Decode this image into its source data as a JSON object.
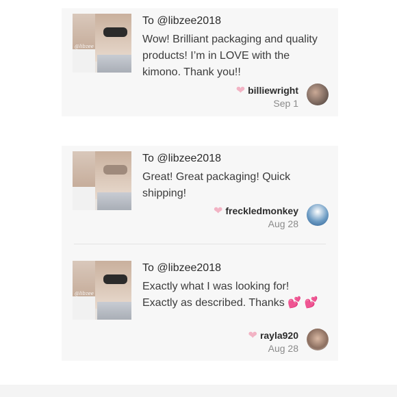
{
  "reviews": [
    {
      "to": "To @libzee2018",
      "message": "Wow! Brilliant packaging and quality products! I’m in LOVE with the kimono. Thank you!!",
      "username": "billiewright",
      "date": "Sep 1",
      "thumb_watermark": "@libzee",
      "avatar_icon": "profile-photo-icon"
    },
    {
      "to": "To @libzee2018",
      "message": "Great! Great packaging! Quick shipping!",
      "username": "freckledmonkey",
      "date": "Aug 28",
      "avatar_icon": "profile-photo-icon"
    },
    {
      "to": "To @libzee2018",
      "message": "Exactly what I was looking for! Exactly as described. Thanks",
      "emoji": "💕",
      "emoji2": "💕",
      "username": "rayla920",
      "date": "Aug 28",
      "thumb_watermark": "@libzee",
      "avatar_icon": "profile-photo-icon"
    }
  ],
  "colors": {
    "card_bg": "#f7f7f7",
    "heart": "#f2b3c4",
    "date_text": "#8a8a8a"
  }
}
